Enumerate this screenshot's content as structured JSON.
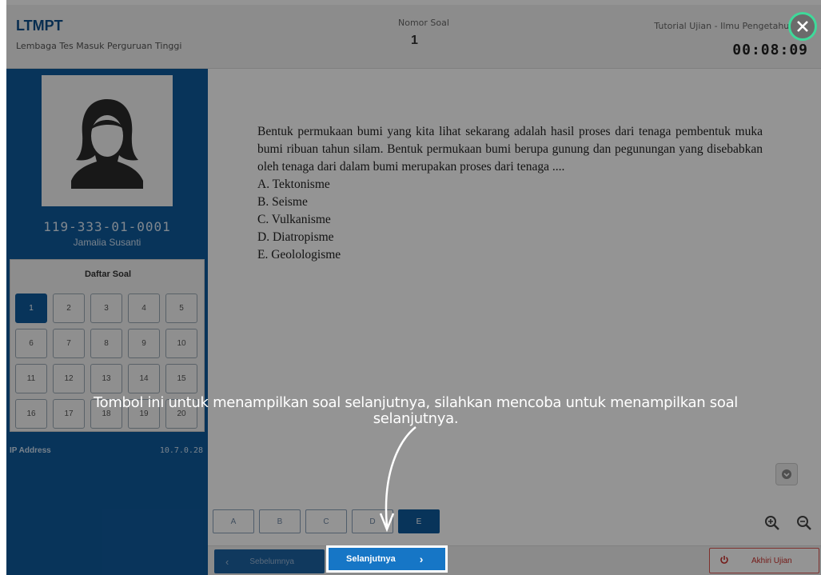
{
  "header": {
    "brand_title": "LTMPT",
    "brand_subtitle": "Lembaga Tes Masuk Perguruan Tinggi",
    "soal_label": "Nomor Soal",
    "soal_number": "1",
    "tutorial_label": "Tutorial Ujian - Ilmu Pengetahuan",
    "timer": "00:08:09"
  },
  "sidebar": {
    "user_id": "119-333-01-0001",
    "user_name": "Jamalia Susanti",
    "grid_title": "Daftar Soal",
    "questions": [
      "1",
      "2",
      "3",
      "4",
      "5",
      "6",
      "7",
      "8",
      "9",
      "10",
      "11",
      "12",
      "13",
      "14",
      "15",
      "16",
      "17",
      "18",
      "19",
      "20"
    ],
    "active_question": "1",
    "ip_label": "IP Address",
    "ip_value": "10.7.0.28"
  },
  "question": {
    "text": "Bentuk permukaan bumi yang kita lihat sekarang adalah hasil proses dari tenaga pembentuk muka bumi ribuan tahun silam. Bentuk permukaan bumi berupa gunung dan pegunungan yang disebabkan oleh tenaga dari dalam bumi merupakan proses dari tenaga ....",
    "options": [
      "A. Tektonisme",
      "B. Seisme",
      "C. Vulkanisme",
      "D. Diatropisme",
      "E. Geolologisme"
    ]
  },
  "answers": {
    "labels": [
      "A",
      "B",
      "C",
      "D",
      "E"
    ],
    "selected": "E"
  },
  "nav": {
    "prev_label": "Sebelumnya",
    "next_label": "Selanjutnya",
    "end_label": "Akhiri Ujian"
  },
  "tutorial": {
    "tooltip": "Tombol ini untuk menampilkan soal selanjutnya, silahkan mencoba untuk menampilkan soal selanjutnya."
  },
  "colors": {
    "brand_blue": "#0f5a9c",
    "next_blue": "#1676c6",
    "danger": "#c9302c",
    "close_ring": "#3fd99a"
  }
}
